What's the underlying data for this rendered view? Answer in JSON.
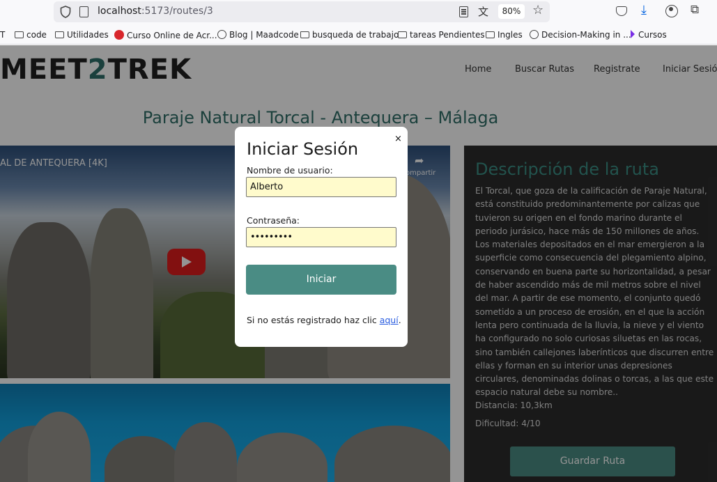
{
  "browser": {
    "url_host": "localhost",
    "url_path": ":5173/routes/3",
    "zoom": "80%",
    "bookmarks": [
      {
        "label": "T",
        "icon": "none"
      },
      {
        "label": "code",
        "icon": "folder-icon"
      },
      {
        "label": "Utilidades",
        "icon": "folder-icon"
      },
      {
        "label": "Curso Online de Acr...",
        "icon": "site-logo-icon"
      },
      {
        "label": "Blog | Maadcode",
        "icon": "globe-icon"
      },
      {
        "label": "busqueda de trabajo",
        "icon": "folder-icon"
      },
      {
        "label": "tareas Pendientes",
        "icon": "folder-icon"
      },
      {
        "label": "Ingles",
        "icon": "folder-icon"
      },
      {
        "label": "Decision-Making in ...",
        "icon": "globe-icon"
      },
      {
        "label": "Cursos",
        "icon": "chevron-icon"
      }
    ]
  },
  "site": {
    "logo_left": "MEET",
    "logo_two": "2",
    "logo_right": "TREK",
    "nav": [
      "Home",
      "Buscar Rutas",
      "Registrate",
      "Iniciar Sesión"
    ]
  },
  "route": {
    "title": "Paraje Natural Torcal - Antequera – Málaga",
    "video_title": "AL DE ANTEQUERA [4K]",
    "share_label": "ompartir",
    "desc_title": "Descripción de la ruta",
    "description": "El Torcal, que goza de la calificación de Paraje Natural, está constituido predominantemente por calizas que tuvieron su origen en el fondo marino durante el periodo jurásico, hace más de 150 millones de años. Los materiales depositados en el mar emergieron a la superficie como consecuencia del plegamiento alpino, conservando en buena parte su horizontalidad, a pesar de haber ascendido más de mil metros sobre el nivel del mar. A partir de ese momento, el conjunto quedó sometido a un proceso de erosión, en el que la acción lenta pero continuada de la lluvia, la nieve y el viento ha configurado no solo curiosas siluetas en las rocas, sino también callejones laberínticos que discurren entre ellas y forman en su interior unas depresiones circulares, denominadas dolinas o torcas, a las que este espacio natural debe su nombre..",
    "distance": "Distancia: 10,3km",
    "difficulty": "Dificultad: 4/10",
    "save_label": "Guardar Ruta"
  },
  "modal": {
    "close": "×",
    "title": "Iniciar Sesión",
    "username_label": "Nombre de usuario:",
    "username_value": "Alberto",
    "password_label": "Contraseña:",
    "password_value": "•••••••••",
    "submit_label": "Iniciar",
    "register_text": "Si no estás registrado haz clic ",
    "register_link": "aquí",
    "register_end": "."
  },
  "colors": {
    "accent": "#4a8c84",
    "title": "#2f6e68",
    "panel": "#2c2c2c",
    "input_bg": "#fffbcc"
  }
}
